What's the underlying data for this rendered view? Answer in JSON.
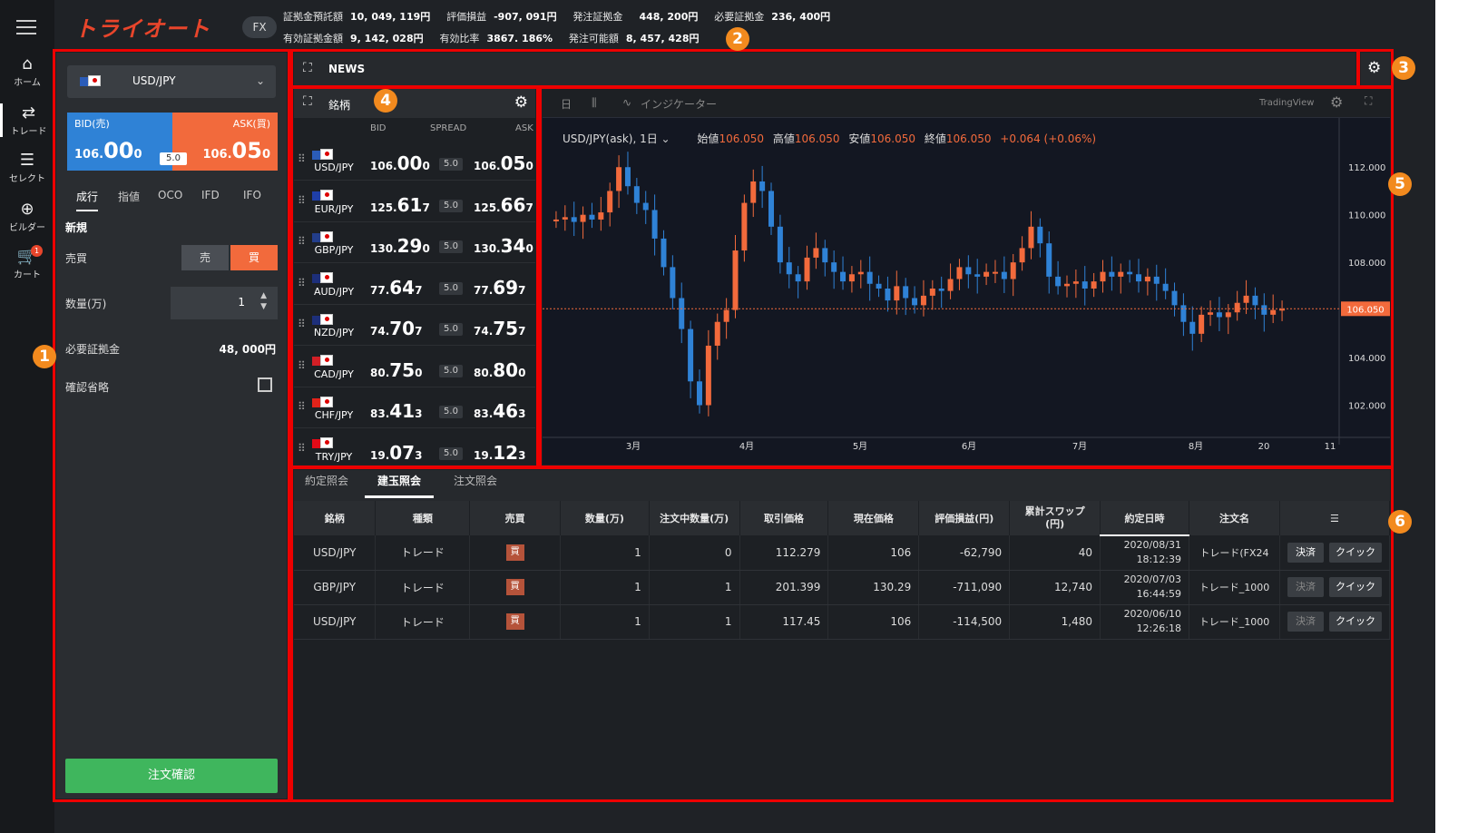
{
  "app": {
    "logo": "トライオート",
    "product_badge": "FX"
  },
  "nav": {
    "items": [
      {
        "label": "ホーム",
        "icon": "home-icon"
      },
      {
        "label": "トレード",
        "icon": "trade-icon"
      },
      {
        "label": "セレクト",
        "icon": "select-icon"
      },
      {
        "label": "ビルダー",
        "icon": "builder-icon"
      },
      {
        "label": "カート",
        "icon": "cart-icon",
        "badge": "1"
      }
    ]
  },
  "account": {
    "row1": [
      {
        "label": "証拠金預託額",
        "value": "10, 049, 119円"
      },
      {
        "label": "評価損益",
        "value": "-907, 091円"
      },
      {
        "label": "発注証拠金",
        "value": "448, 200円"
      },
      {
        "label": "必要証拠金",
        "value": "236, 400円"
      }
    ],
    "row2": [
      {
        "label": "有効証拠金額",
        "value": "9, 142, 028円"
      },
      {
        "label": "有効比率",
        "value": "3867. 186%"
      },
      {
        "label": "発注可能額",
        "value": "8, 457, 428円"
      }
    ]
  },
  "annotations": [
    "1",
    "2",
    "3",
    "4",
    "5",
    "6"
  ],
  "order_panel": {
    "pair": "USD/JPY",
    "bid_label": "BID(売)",
    "ask_label": "ASK(買)",
    "bid_big": "106.",
    "bid_main": "00",
    "bid_small": "0",
    "ask_big": "106.",
    "ask_main": "05",
    "ask_small": "0",
    "spread": "5.0",
    "tabs": [
      "成行",
      "指値",
      "OCO",
      "IFD",
      "IFO"
    ],
    "section": "新規",
    "side_label": "売買",
    "sell": "売",
    "buy": "買",
    "qty_label": "数量(万)",
    "qty_value": "1",
    "margin_label": "必要証拠金",
    "margin_value": "48, 000円",
    "skip_confirm_label": "確認省略",
    "confirm_button": "注文確認"
  },
  "news": {
    "title": "NEWS"
  },
  "rates": {
    "title": "銘柄",
    "columns": [
      "BID",
      "SPREAD",
      "ASK"
    ],
    "rows": [
      {
        "pair": "USD/JPY",
        "bid_a": "106.",
        "bid_b": "00",
        "bid_c": "0",
        "spread": "5.0",
        "ask_a": "106.",
        "ask_b": "05",
        "ask_c": "0",
        "flag": "#2b5cb8"
      },
      {
        "pair": "EUR/JPY",
        "bid_a": "125.",
        "bid_b": "61",
        "bid_c": "7",
        "spread": "5.0",
        "ask_a": "125.",
        "ask_b": "66",
        "ask_c": "7",
        "flag": "#1f3fa8"
      },
      {
        "pair": "GBP/JPY",
        "bid_a": "130.",
        "bid_b": "29",
        "bid_c": "0",
        "spread": "5.0",
        "ask_a": "130.",
        "ask_b": "34",
        "ask_c": "0",
        "flag": "#233e8b"
      },
      {
        "pair": "AUD/JPY",
        "bid_a": "77.",
        "bid_b": "64",
        "bid_c": "7",
        "spread": "5.0",
        "ask_a": "77.",
        "ask_b": "69",
        "ask_c": "7",
        "flag": "#1d2f7a"
      },
      {
        "pair": "NZD/JPY",
        "bid_a": "74.",
        "bid_b": "70",
        "bid_c": "7",
        "spread": "5.0",
        "ask_a": "74.",
        "ask_b": "75",
        "ask_c": "7",
        "flag": "#1d2f7a"
      },
      {
        "pair": "CAD/JPY",
        "bid_a": "80.",
        "bid_b": "75",
        "bid_c": "0",
        "spread": "5.0",
        "ask_a": "80.",
        "ask_b": "80",
        "ask_c": "0",
        "flag": "#d21f26"
      },
      {
        "pair": "CHF/JPY",
        "bid_a": "83.",
        "bid_b": "41",
        "bid_c": "3",
        "spread": "5.0",
        "ask_a": "83.",
        "ask_b": "46",
        "ask_c": "3",
        "flag": "#e2231a"
      },
      {
        "pair": "TRY/JPY",
        "bid_a": "19.",
        "bid_b": "07",
        "bid_c": "3",
        "spread": "5.0",
        "ask_a": "19.",
        "ask_b": "12",
        "ask_c": "3",
        "flag": "#e30a17"
      }
    ]
  },
  "chart": {
    "toolbar": {
      "period": "日",
      "indicator": "インジケーター",
      "brand": "TradingView"
    },
    "legend": {
      "symbol": "USD/JPY(ask), 1日",
      "open_label": "始値",
      "open": "106.050",
      "high_label": "高値",
      "high": "106.050",
      "low_label": "安値",
      "low": "106.050",
      "close_label": "終値",
      "close": "106.050",
      "change": "+0.064 (+0.06%)"
    },
    "colors": {
      "up": "#f26a3c",
      "down": "#2f82d6",
      "bg": "#131722"
    }
  },
  "chart_data": {
    "type": "candlestick",
    "title": "",
    "ylim": [
      100.8,
      113.0
    ],
    "y_ticks": [
      "112.000",
      "110.000",
      "108.000",
      "106.000",
      "104.000",
      "102.000"
    ],
    "y_tick_values": [
      112,
      110,
      108,
      106,
      104,
      102
    ],
    "x_ticks": [
      "3月",
      "4月",
      "5月",
      "6月",
      "7月",
      "8月",
      "20",
      "11"
    ],
    "last_price_label": "106.050",
    "last_price": 106.05,
    "close_series": [
      109.8,
      109.9,
      109.7,
      110.0,
      109.8,
      110.1,
      111.0,
      112.0,
      111.2,
      110.5,
      110.2,
      109.0,
      107.8,
      106.5,
      105.2,
      103.0,
      102.0,
      104.5,
      105.5,
      106.0,
      108.5,
      110.5,
      111.4,
      111.0,
      109.5,
      108.0,
      107.5,
      107.2,
      108.2,
      108.6,
      108.0,
      107.6,
      107.2,
      107.5,
      107.6,
      107.1,
      106.9,
      106.4,
      107.0,
      106.5,
      106.2,
      106.6,
      106.9,
      106.8,
      107.3,
      107.8,
      107.5,
      107.4,
      107.6,
      107.6,
      107.3,
      108.0,
      108.6,
      109.5,
      108.8,
      107.4,
      107.0,
      107.1,
      107.2,
      106.9,
      107.2,
      107.6,
      107.4,
      107.6,
      107.5,
      107.2,
      107.4,
      107.1,
      106.8,
      106.2,
      105.5,
      105.0,
      105.8,
      105.9,
      105.7,
      105.9,
      106.3,
      106.6,
      106.2,
      105.8,
      106.0,
      106.05
    ],
    "xlabel": "",
    "ylabel": ""
  },
  "orders": {
    "tabs": [
      "約定照会",
      "建玉照会",
      "注文照会"
    ],
    "active_tab": 1,
    "columns": [
      "銘柄",
      "種類",
      "売買",
      "数量(万)",
      "注文中数量(万)",
      "取引価格",
      "現在価格",
      "評価損益(円)",
      "累計スワップ\n(円)",
      "約定日時",
      "注文名"
    ],
    "rows": [
      {
        "pair": "USD/JPY",
        "type": "トレード",
        "side": "買",
        "qty": "1",
        "pending": "0",
        "price": "112.279",
        "current": "106",
        "pl": "-62,790",
        "swap": "40",
        "date": "2020/08/31",
        "time": "18:12:39",
        "name": "トレード(FX24",
        "settle": "決済",
        "quick": "クイック",
        "settle_dim": false
      },
      {
        "pair": "GBP/JPY",
        "type": "トレード",
        "side": "買",
        "qty": "1",
        "pending": "1",
        "price": "201.399",
        "current": "130.29",
        "pl": "-711,090",
        "swap": "12,740",
        "date": "2020/07/03",
        "time": "16:44:59",
        "name": "トレード_1000",
        "settle": "決済",
        "quick": "クイック",
        "settle_dim": true
      },
      {
        "pair": "USD/JPY",
        "type": "トレード",
        "side": "買",
        "qty": "1",
        "pending": "1",
        "price": "117.45",
        "current": "106",
        "pl": "-114,500",
        "swap": "1,480",
        "date": "2020/06/10",
        "time": "12:26:18",
        "name": "トレード_1000",
        "settle": "決済",
        "quick": "クイック",
        "settle_dim": true
      }
    ]
  }
}
